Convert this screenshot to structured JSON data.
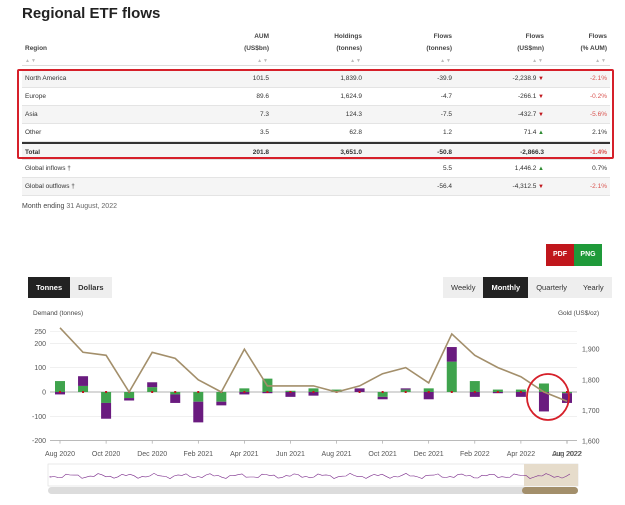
{
  "page": {
    "title": "Regional ETF flows",
    "month_note_label": "Month ending",
    "month_note_date": "31 August, 2022"
  },
  "table": {
    "headers": [
      {
        "line1": "",
        "line2": "Region"
      },
      {
        "line1": "AUM",
        "line2": "(US$bn)"
      },
      {
        "line1": "Holdings",
        "line2": "(tonnes)"
      },
      {
        "line1": "Flows",
        "line2": "(tonnes)"
      },
      {
        "line1": "Flows",
        "line2": "(US$mn)"
      },
      {
        "line1": "Flows",
        "line2": "(% AUM)"
      }
    ],
    "sort_glyph": "▲▼",
    "rows": [
      {
        "region": "North America",
        "aum": "101.5",
        "holdings": "1,839.0",
        "flows_t": "-39.9",
        "flows_usd": "-2,238.9",
        "dir": "down",
        "flows_pct": "-2.1%"
      },
      {
        "region": "Europe",
        "aum": "89.6",
        "holdings": "1,624.9",
        "flows_t": "-4.7",
        "flows_usd": "-266.1",
        "dir": "down",
        "flows_pct": "-0.2%"
      },
      {
        "region": "Asia",
        "aum": "7.3",
        "holdings": "124.3",
        "flows_t": "-7.5",
        "flows_usd": "-432.7",
        "dir": "down",
        "flows_pct": "-5.6%"
      },
      {
        "region": "Other",
        "aum": "3.5",
        "holdings": "62.8",
        "flows_t": "1.2",
        "flows_usd": "71.4",
        "dir": "up",
        "flows_pct": "2.1%"
      },
      {
        "region": "Total",
        "aum": "201.8",
        "holdings": "3,651.0",
        "flows_t": "-50.8",
        "flows_usd": "-2,866.3",
        "dir": "",
        "flows_pct": "-1.4%"
      },
      {
        "region": "Global inflows †",
        "aum": "",
        "holdings": "",
        "flows_t": "5.5",
        "flows_usd": "1,446.2",
        "dir": "up",
        "flows_pct": "0.7%"
      },
      {
        "region": "Global outflows †",
        "aum": "",
        "holdings": "",
        "flows_t": "-56.4",
        "flows_usd": "-4,312.5",
        "dir": "down",
        "flows_pct": "-2.1%"
      }
    ]
  },
  "export": {
    "pdf": "PDF",
    "png": "PNG"
  },
  "unit_toggle": [
    "Tonnes",
    "Dollars"
  ],
  "period_toggle": [
    "Weekly",
    "Monthly",
    "Quarterly",
    "Yearly"
  ],
  "colors": {
    "purple": "#6a1b7f",
    "green": "#3fa34d",
    "gold_line": "#a38f6b",
    "accent_red": "#c0161c"
  },
  "chart_data": {
    "type": "bar",
    "ylabel": "Demand (tonnes)",
    "y2label": "Gold (US$/oz)",
    "ylim": [
      -200,
      250
    ],
    "y2lim": [
      1600,
      1950
    ],
    "yticks": [
      "250",
      "200",
      "100",
      "0",
      "-100",
      "-200"
    ],
    "y2ticks": [
      "1,900",
      "1,800",
      "1,700",
      "1,600"
    ],
    "xticks": [
      "Aug 2020",
      "Oct 2020",
      "Dec 2020",
      "Feb 2021",
      "Apr 2021",
      "Jun 2021",
      "Aug 2021",
      "Oct 2021",
      "Dec 2021",
      "Feb 2022",
      "Apr 2022",
      "Jun 2022",
      "Aug 2022"
    ],
    "series": [
      {
        "name": "North America",
        "values": [
          -10,
          40,
          -65,
          -10,
          20,
          -35,
          -85,
          -15,
          -10,
          -5,
          -20,
          -15,
          0,
          15,
          -10,
          5,
          -30,
          60,
          -20,
          -5,
          -20,
          -80,
          -40
        ]
      },
      {
        "name": "Europe",
        "values": [
          45,
          25,
          -45,
          -25,
          20,
          -10,
          -40,
          -40,
          15,
          55,
          5,
          15,
          10,
          0,
          -20,
          10,
          15,
          125,
          45,
          10,
          10,
          35,
          -5
        ]
      },
      {
        "name": "Gold price",
        "values": [
          1970,
          1890,
          1880,
          1760,
          1890,
          1870,
          1800,
          1760,
          1900,
          1780,
          1780,
          1780,
          1760,
          1780,
          1820,
          1840,
          1790,
          1950,
          1880,
          1840,
          1810,
          1760,
          1730
        ]
      }
    ]
  }
}
